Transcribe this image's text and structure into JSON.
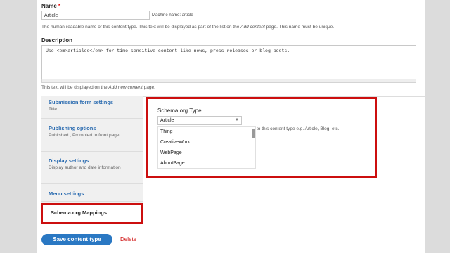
{
  "name_field": {
    "label": "Name",
    "required_mark": "*",
    "value": "Article",
    "machine_name": "Machine name: article",
    "help_before": "The human-readable name of this content type. This text will be displayed as part of the list on the ",
    "help_em": "Add content",
    "help_after": " page. This name must be unique."
  },
  "description_field": {
    "label": "Description",
    "value": "Use <em>articles</em> for time-sensitive content like news, press releases or blog posts.",
    "help_before": "This text will be displayed on the ",
    "help_em": "Add new content",
    "help_after": " page."
  },
  "vertical_tabs": [
    {
      "title": "Submission form settings",
      "summary": "Title"
    },
    {
      "title": "Publishing options",
      "summary": "Published , Promoted to front page"
    },
    {
      "title": "Display settings",
      "summary": "Display author and date information"
    },
    {
      "title": "Menu settings",
      "summary": ""
    },
    {
      "title": "Schema.org Mappings",
      "summary": "",
      "active": true
    }
  ],
  "schema_panel": {
    "label": "Schema.org Type",
    "selected": "Article",
    "options": [
      "Thing",
      "CreativeWork",
      "WebPage",
      "AboutPage"
    ],
    "hint": "to this content type e.g. Article, Blog, etc."
  },
  "actions": {
    "save_label": "Save content type",
    "delete_label": "Delete"
  },
  "colors": {
    "highlight": "#cc0f0f",
    "primary_button": "#2a78c3",
    "link": "#2a6bb0",
    "danger_link": "#cc0000"
  }
}
